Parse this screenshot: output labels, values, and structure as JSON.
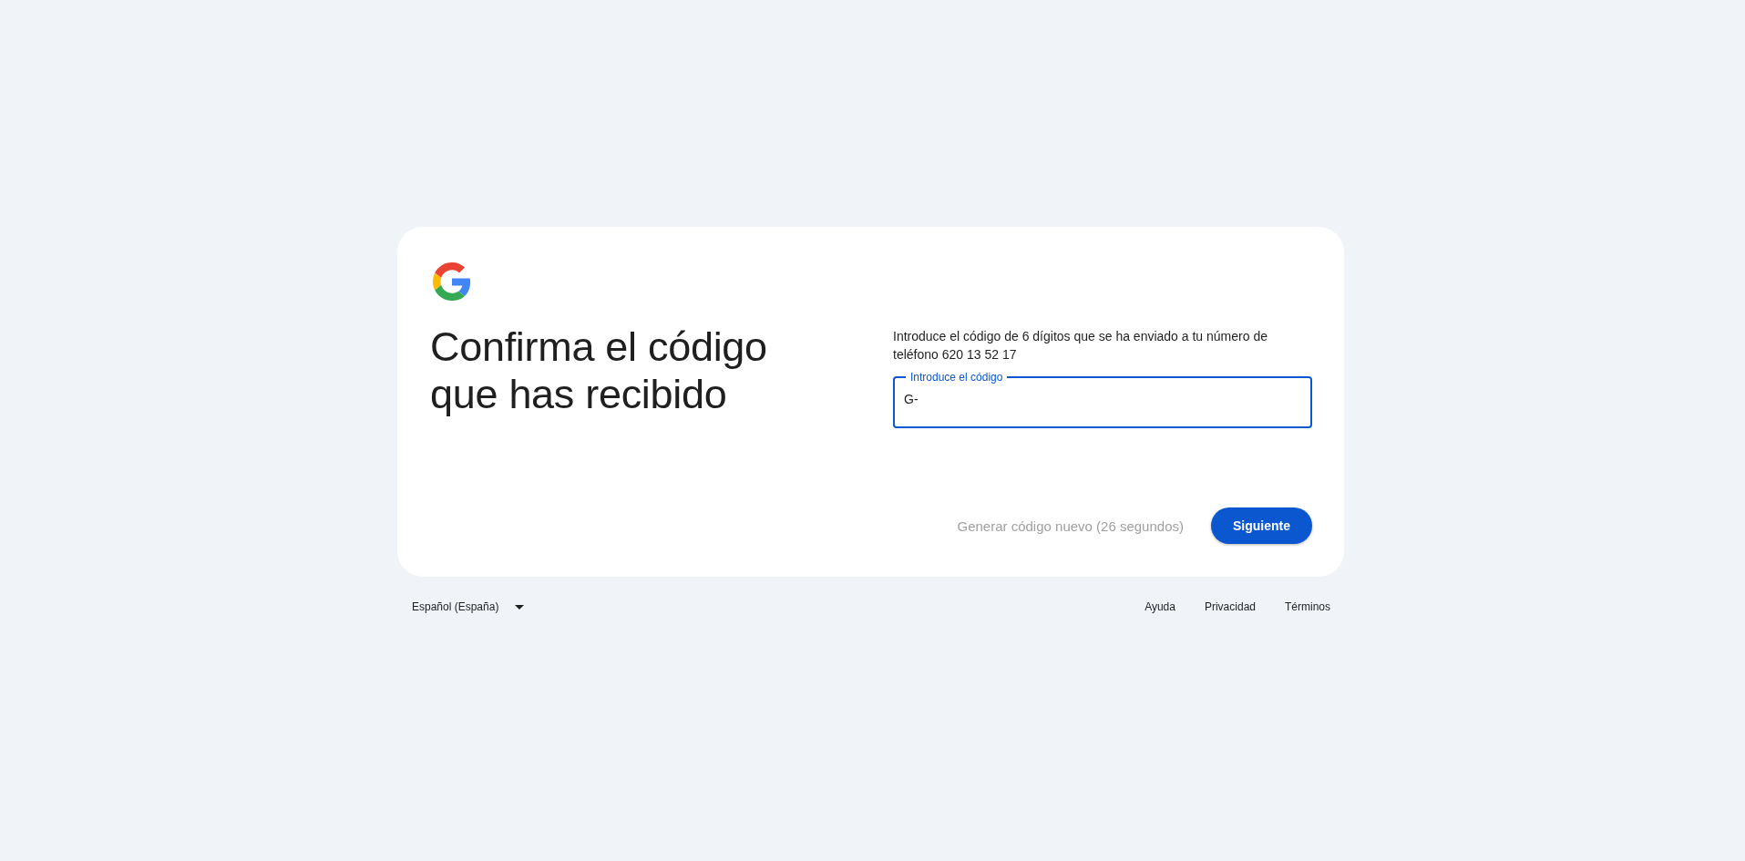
{
  "card": {
    "heading": "Confirma el código que has recibido",
    "instructions": "Introduce el código de 6 dígitos que se ha enviado a tu número de teléfono 620 13 52 17",
    "code_field": {
      "label": "Introduce el código",
      "value": "G-",
      "focused": true
    },
    "resend_link": {
      "label": "Generar código nuevo (26 segundos)",
      "disabled": true
    },
    "next_button": {
      "label": "Siguiente"
    }
  },
  "footer": {
    "language": "Español (España)",
    "links": [
      "Ayuda",
      "Privacidad",
      "Términos"
    ]
  }
}
